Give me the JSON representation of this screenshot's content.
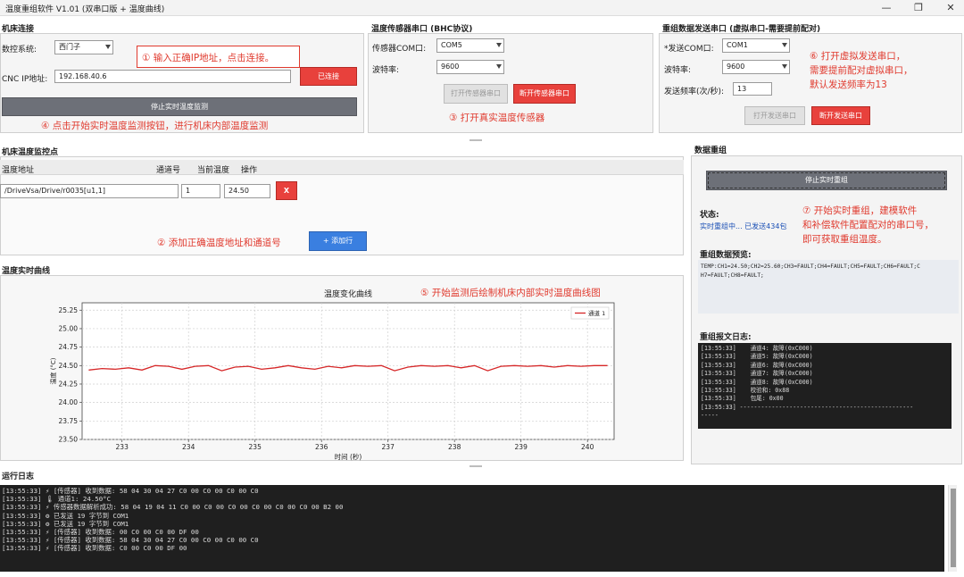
{
  "window": {
    "title": "温度重组软件 V1.01 (双串口版 + 温度曲线)",
    "minimize": "—",
    "maximize": "❐",
    "close": "✕"
  },
  "cnc": {
    "section_title": "机床连接",
    "system_label": "数控系统:",
    "system_value": "西门子",
    "ip_label": "CNC IP地址:",
    "ip_value": "192.168.40.6",
    "connect_button": "已连接",
    "monitor_button": "停止实时温度监测"
  },
  "sensor": {
    "section_title": "温度传感器串口 (BHC协议)",
    "com_label": "传感器COM口:",
    "com_value": "COM5",
    "baud_label": "波特率:",
    "baud_value": "9600",
    "open_button": "打开传感器串口",
    "close_button": "断开传感器串口"
  },
  "sender": {
    "section_title": "重组数据发送串口 (虚拟串口-需要提前配对)",
    "com_label": "*发送COM口:",
    "com_value": "COM1",
    "baud_label": "波特率:",
    "baud_value": "9600",
    "freq_label": "发送频率(次/秒):",
    "freq_value": "13",
    "open_button": "打开发送串口",
    "close_button": "断开发送串口"
  },
  "annotations": {
    "a1": "① 输入正确IP地址，点击连接。",
    "a2": "② 添加正确温度地址和通道号",
    "a3": "③ 打开真实温度传感器",
    "a4": "④ 点击开始实时温度监测按钮，进行机床内部温度监测",
    "a5": "⑤ 开始监测后绘制机床内部实时温度曲线图",
    "a6_l1": "⑥ 打开虚拟发送串口，",
    "a6_l2": "需要提前配对虚拟串口，",
    "a6_l3": "默认发送频率为13",
    "a7_l1": "⑦ 开始实时重组，建模软件",
    "a7_l2": "和补偿软件配置配对的串口号，",
    "a7_l3": "即可获取重组温度。"
  },
  "monitor": {
    "section_title": "机床温度监控点",
    "col_address": "温度地址",
    "col_channel": "通道号",
    "col_current": "当前温度",
    "col_action": "操作",
    "row_address": "/DriveVsa/Drive/r0035[u1,1]",
    "row_channel": "1",
    "row_current": "24.50",
    "delete_button": "X",
    "add_button": "+ 添加行"
  },
  "curve": {
    "section_title": "温度实时曲线"
  },
  "chart_data": {
    "type": "line",
    "title": "温度变化曲线",
    "xlabel": "时间 (秒)",
    "ylabel": "温度 (°C)",
    "xlim": [
      232.4,
      240.4
    ],
    "ylim": [
      23.5,
      25.35
    ],
    "xticks": [
      233,
      234,
      235,
      236,
      237,
      238,
      239,
      240
    ],
    "yticks": [
      23.5,
      23.75,
      24.0,
      24.25,
      24.5,
      24.75,
      25.0,
      25.25
    ],
    "grid": true,
    "legend": "top-right",
    "series": [
      {
        "name": "通道 1",
        "color": "#d62728",
        "x": [
          232.5,
          232.7,
          232.9,
          233.1,
          233.3,
          233.5,
          233.7,
          233.9,
          234.1,
          234.3,
          234.5,
          234.7,
          234.9,
          235.1,
          235.3,
          235.5,
          235.7,
          235.9,
          236.1,
          236.3,
          236.5,
          236.7,
          236.9,
          237.1,
          237.3,
          237.5,
          237.7,
          237.9,
          238.1,
          238.3,
          238.5,
          238.7,
          238.9,
          239.1,
          239.3,
          239.5,
          239.7,
          239.9,
          240.1,
          240.3
        ],
        "values": [
          24.44,
          24.46,
          24.45,
          24.47,
          24.44,
          24.5,
          24.49,
          24.45,
          24.49,
          24.5,
          24.43,
          24.48,
          24.49,
          24.45,
          24.47,
          24.5,
          24.47,
          24.45,
          24.49,
          24.47,
          24.5,
          24.49,
          24.5,
          24.43,
          24.48,
          24.5,
          24.49,
          24.5,
          24.47,
          24.5,
          24.43,
          24.49,
          24.5,
          24.49,
          24.5,
          24.48,
          24.5,
          24.49,
          24.5,
          24.5
        ]
      }
    ]
  },
  "regroup": {
    "section_title": "数据重组",
    "stop_button": "停止实时重组",
    "status_label": "状态:",
    "status_value": "实时重组中... 已发送434包",
    "preview_label": "重组数据预览:",
    "preview_line1": "TEMP:CH1=24.50;CH2=25.60;CH3=FAULT;CH4=FAULT;CH5=FAULT;CH6=FAULT;C",
    "preview_line2": "H7=FAULT;CH8=FAULT;",
    "log_label": "重组报文日志:",
    "log_lines": [
      "[13:55:33]    通道4: 故障(0xC000)",
      "[13:55:33]    通道5: 故障(0xC000)",
      "[13:55:33]    通道6: 故障(0xC000)",
      "[13:55:33]    通道7: 故障(0xC000)",
      "[13:55:33]    通道8: 故障(0xC000)",
      "[13:55:33]    校验和: 0x88",
      "[13:55:33]    包尾: 0x00",
      "[13:55:33] -------------------------------------------------",
      "-----"
    ]
  },
  "runlog": {
    "section_title": "运行日志",
    "lines": [
      "[13:55:33] ⚡ [传感器] 收到数据: 58 04 30 04 27 C0 00 C0 00 C0 00 C0",
      "[13:55:33] 🌡 通道1: 24.50°C",
      "[13:55:33] ⚡ 传感器数据解析成功: 58 04 19 04 11 C0 00 C0 00 C0 00 C0 00 C0 00 C0 00 B2 00",
      "[13:55:33] ⚙ 已发送 19 字节到 COM1",
      "[13:55:33] ⚙ 已发送 19 字节到 COM1",
      "[13:55:33] ⚡ [传感器] 收到数据: 00 C0 00 C0 00 DF 00",
      "[13:55:33] ⚡ [传感器] 收到数据: 58 04 30 04 27 C0 00 C0 00 C0 00 C0",
      "[13:55:33] ⚡ [传感器] 收到数据: C0 00 C0 00 DF 00"
    ]
  }
}
